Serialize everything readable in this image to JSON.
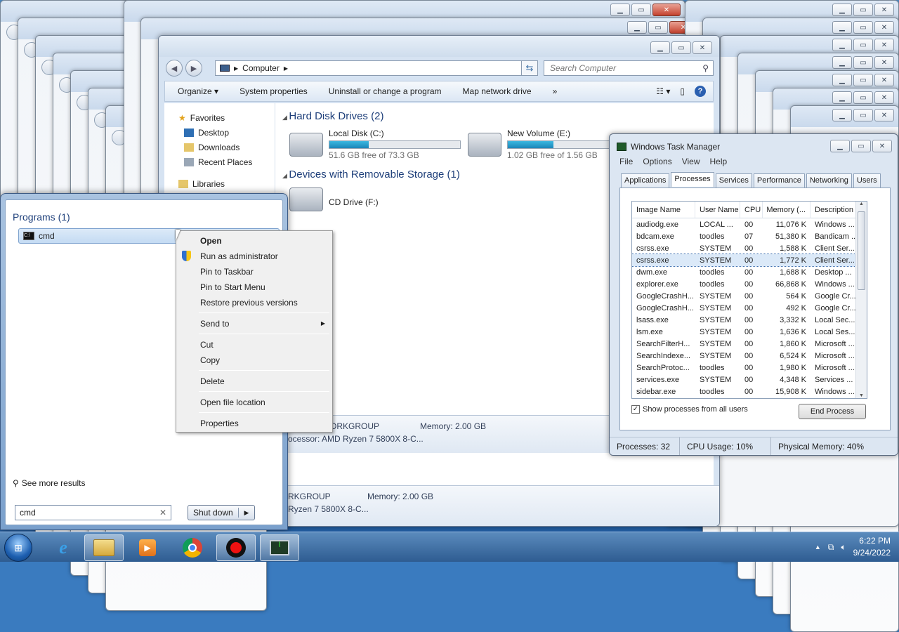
{
  "explorer": {
    "address": "Computer",
    "search_placeholder": "Search Computer",
    "toolbar": {
      "organize": "Organize",
      "system_properties": "System properties",
      "uninstall": "Uninstall or change a program",
      "map_drive": "Map network drive",
      "more": "»"
    },
    "nav": [
      "Favorites",
      "Desktop",
      "Downloads",
      "Recent Places",
      "Libraries"
    ],
    "groups": {
      "hdd": "Hard Disk Drives (2)",
      "removable": "Devices with Removable Storage (1)"
    },
    "drives": [
      {
        "name": "Local Disk (C:)",
        "free": "51.6 GB free of 73.3 GB",
        "used_fraction": 0.3
      },
      {
        "name": "New Volume (E:)",
        "free": "1.02 GB free of 1.56 GB",
        "used_fraction": 0.35
      }
    ],
    "cd": "CD Drive (F:)",
    "details": {
      "workgroup": "ORKGROUP",
      "memory": "Memory: 2.00 GB",
      "processor": "rocessor: AMD Ryzen 7 5800X 8-C...",
      "workgroup2": "RKGROUP",
      "memory2": "Memory: 2.00 GB",
      "processor2": "Ryzen 7 5800X 8-C..."
    }
  },
  "taskmgr": {
    "title": "Windows Task Manager",
    "menu": [
      "File",
      "Options",
      "View",
      "Help"
    ],
    "tabs": [
      "Applications",
      "Processes",
      "Services",
      "Performance",
      "Networking",
      "Users"
    ],
    "columns": [
      "Image Name",
      "User Name",
      "CPU",
      "Memory (...",
      "Description"
    ],
    "rows": [
      [
        "audiodg.exe",
        "LOCAL ...",
        "00",
        "11,076 K",
        "Windows ..."
      ],
      [
        "bdcam.exe",
        "toodles",
        "07",
        "51,380 K",
        "Bandicam ..."
      ],
      [
        "csrss.exe",
        "SYSTEM",
        "00",
        "1,588 K",
        "Client Ser..."
      ],
      [
        "csrss.exe",
        "SYSTEM",
        "00",
        "1,772 K",
        "Client Ser..."
      ],
      [
        "dwm.exe",
        "toodles",
        "00",
        "1,688 K",
        "Desktop ..."
      ],
      [
        "explorer.exe",
        "toodles",
        "00",
        "66,868 K",
        "Windows ..."
      ],
      [
        "GoogleCrashH...",
        "SYSTEM",
        "00",
        "564 K",
        "Google Cr..."
      ],
      [
        "GoogleCrashH...",
        "SYSTEM",
        "00",
        "492 K",
        "Google Cr..."
      ],
      [
        "lsass.exe",
        "SYSTEM",
        "00",
        "3,332 K",
        "Local Sec..."
      ],
      [
        "lsm.exe",
        "SYSTEM",
        "00",
        "1,636 K",
        "Local Ses..."
      ],
      [
        "SearchFilterH...",
        "SYSTEM",
        "00",
        "1,860 K",
        "Microsoft ..."
      ],
      [
        "SearchIndexe...",
        "SYSTEM",
        "00",
        "6,524 K",
        "Microsoft ..."
      ],
      [
        "SearchProtoc...",
        "toodles",
        "00",
        "1,980 K",
        "Microsoft ..."
      ],
      [
        "services.exe",
        "SYSTEM",
        "00",
        "4,348 K",
        "Services ..."
      ],
      [
        "sidebar.exe",
        "toodles",
        "00",
        "15,908 K",
        "Windows ..."
      ]
    ],
    "show_all": "Show processes from all users",
    "end_process": "End Process",
    "status": {
      "processes": "Processes: 32",
      "cpu": "CPU Usage: 10%",
      "memory": "Physical Memory: 40%"
    }
  },
  "start": {
    "programs_header": "Programs (1)",
    "program": "cmd",
    "see_more": "See more results",
    "search_value": "cmd",
    "shutdown": "Shut down"
  },
  "context_menu": {
    "open": "Open",
    "run_admin": "Run as administrator",
    "pin_taskbar": "Pin to Taskbar",
    "pin_start": "Pin to Start Menu",
    "restore": "Restore previous versions",
    "send_to": "Send to",
    "cut": "Cut",
    "copy": "Copy",
    "delete": "Delete",
    "open_location": "Open file location",
    "properties": "Properties"
  },
  "taskbar": {
    "time": "6:22 PM",
    "date": "9/24/2022"
  }
}
